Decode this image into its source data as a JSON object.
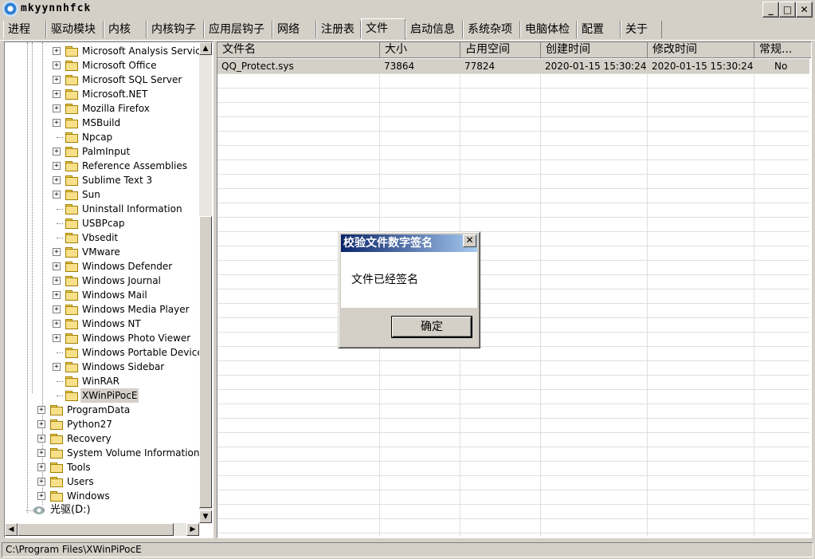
{
  "window": {
    "title": "mkyynnhfck",
    "buttons": {
      "minimize": "_",
      "maximize": "□",
      "close": "✕"
    }
  },
  "tabs": [
    {
      "label": "进程"
    },
    {
      "label": "驱动模块"
    },
    {
      "label": "内核"
    },
    {
      "label": "内核钩子"
    },
    {
      "label": "应用层钩子"
    },
    {
      "label": "网络"
    },
    {
      "label": "注册表"
    },
    {
      "label": "文件",
      "active": true
    },
    {
      "label": "启动信息"
    },
    {
      "label": "系统杂项"
    },
    {
      "label": "电脑体检"
    },
    {
      "label": "配置"
    },
    {
      "label": "关于"
    }
  ],
  "tree": {
    "items": [
      {
        "label": "Microsoft Analysis Services",
        "level": 2,
        "expandable": true
      },
      {
        "label": "Microsoft Office",
        "level": 2,
        "expandable": true
      },
      {
        "label": "Microsoft SQL Server",
        "level": 2,
        "expandable": true
      },
      {
        "label": "Microsoft.NET",
        "level": 2,
        "expandable": true
      },
      {
        "label": "Mozilla Firefox",
        "level": 2,
        "expandable": true
      },
      {
        "label": "MSBuild",
        "level": 2,
        "expandable": true
      },
      {
        "label": "Npcap",
        "level": 2,
        "expandable": false
      },
      {
        "label": "PalmInput",
        "level": 2,
        "expandable": true
      },
      {
        "label": "Reference Assemblies",
        "level": 2,
        "expandable": true
      },
      {
        "label": "Sublime Text 3",
        "level": 2,
        "expandable": true
      },
      {
        "label": "Sun",
        "level": 2,
        "expandable": true
      },
      {
        "label": "Uninstall Information",
        "level": 2,
        "expandable": false
      },
      {
        "label": "USBPcap",
        "level": 2,
        "expandable": false
      },
      {
        "label": "Vbsedit",
        "level": 2,
        "expandable": false
      },
      {
        "label": "VMware",
        "level": 2,
        "expandable": true
      },
      {
        "label": "Windows Defender",
        "level": 2,
        "expandable": true
      },
      {
        "label": "Windows Journal",
        "level": 2,
        "expandable": true
      },
      {
        "label": "Windows Mail",
        "level": 2,
        "expandable": true
      },
      {
        "label": "Windows Media Player",
        "level": 2,
        "expandable": true
      },
      {
        "label": "Windows NT",
        "level": 2,
        "expandable": true
      },
      {
        "label": "Windows Photo Viewer",
        "level": 2,
        "expandable": true
      },
      {
        "label": "Windows Portable Devices",
        "level": 2,
        "expandable": false
      },
      {
        "label": "Windows Sidebar",
        "level": 2,
        "expandable": true
      },
      {
        "label": "WinRAR",
        "level": 2,
        "expandable": false
      },
      {
        "label": "XWinPiPocE",
        "level": 2,
        "expandable": false,
        "selected": true
      },
      {
        "label": "ProgramData",
        "level": 1,
        "expandable": true
      },
      {
        "label": "Python27",
        "level": 1,
        "expandable": true
      },
      {
        "label": "Recovery",
        "level": 1,
        "expandable": true
      },
      {
        "label": "System Volume Information",
        "level": 1,
        "expandable": true
      },
      {
        "label": "Tools",
        "level": 1,
        "expandable": true
      },
      {
        "label": "Users",
        "level": 1,
        "expandable": true
      },
      {
        "label": "Windows",
        "level": 1,
        "expandable": true
      },
      {
        "label": "光驱(D:)",
        "level": 0,
        "expandable": false,
        "drive": true
      }
    ]
  },
  "file_list": {
    "columns": [
      "文件名",
      "大小",
      "占用空间",
      "创建时间",
      "修改时间",
      "常规..."
    ],
    "rows": [
      [
        "QQ_Protect.sys",
        "73864",
        "77824",
        "2020-01-15 15:30:24",
        "2020-01-15 15:30:24",
        "No"
      ]
    ]
  },
  "status": {
    "path": "C:\\Program Files\\XWinPiPocE"
  },
  "dialog": {
    "title": "校验文件数字签名",
    "message": "文件已经签名",
    "ok_label": "确定",
    "close": "✕"
  },
  "icons": [
    "app-icon",
    "folder-icon",
    "expand-plus-icon",
    "drive-icon",
    "scroll-up-icon",
    "scroll-down-icon",
    "scroll-left-icon",
    "scroll-right-icon"
  ],
  "colors": {
    "face": "#d4d0c8",
    "dialog_title": "#0a246a",
    "window_bg": "#ffffff"
  }
}
